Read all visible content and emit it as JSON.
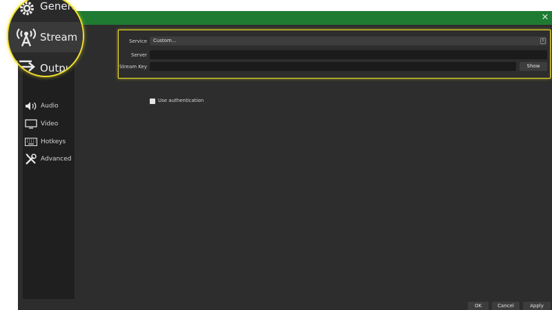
{
  "sidebar": {
    "items": [
      {
        "label": "Audio",
        "icon": "speaker-icon"
      },
      {
        "label": "Video",
        "icon": "monitor-icon"
      },
      {
        "label": "Hotkeys",
        "icon": "keyboard-icon"
      },
      {
        "label": "Advanced",
        "icon": "tools-icon"
      }
    ]
  },
  "zoom": {
    "general": "General",
    "stream": "Stream",
    "output": "Output"
  },
  "form": {
    "service_label": "Service",
    "service_value": "Custom...",
    "server_label": "Server",
    "server_value": "",
    "stream_key_label": "Stream Key",
    "stream_key_value": "",
    "show_button": "Show",
    "auth_label": "Use authentication"
  },
  "footer": {
    "ok": "OK",
    "cancel": "Cancel",
    "apply": "Apply"
  },
  "colors": {
    "titlebar": "#1f7a32",
    "highlight": "#f2e12b"
  }
}
